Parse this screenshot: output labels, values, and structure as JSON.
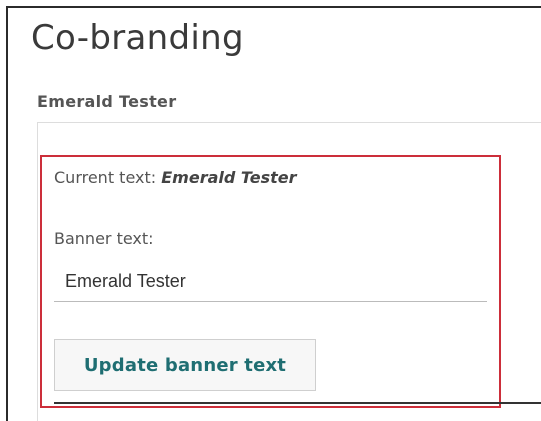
{
  "page": {
    "title": "Co-branding",
    "organization": "Emerald Tester"
  },
  "cobranding_form": {
    "current_text_label": "Current text:",
    "current_text_value": "Emerald Tester",
    "banner_text_label": "Banner text:",
    "banner_text_value": "Emerald Tester",
    "update_button_label": "Update banner text"
  },
  "colors": {
    "highlight_border": "#cc2e3a",
    "button_text": "#1f6e72"
  }
}
